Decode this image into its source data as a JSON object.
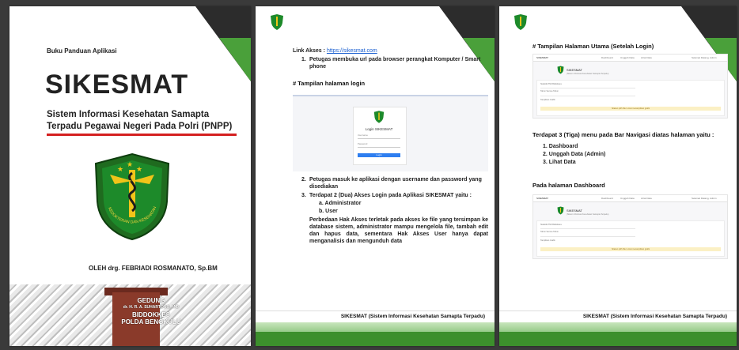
{
  "cover": {
    "guide_label": "Buku Panduan Aplikasi",
    "title": "SIKESMAT",
    "subtitle_line1": "Sistem Informasi Kesehatan Samapta",
    "subtitle_line2": "Terpadu Pegawai Negeri Pada Polri (PNPP)",
    "emblem_ring_text": "KEDOKTERAN DAN KESEHATAN",
    "author": "OLEH drg. FEBRIADI ROSMANATO, Sp.BM",
    "building_line1": "GEDUNG",
    "building_line2": "dr. H. R. A. SUHARTONO, M.D",
    "building_line3": "BIDDOKKES",
    "building_line4": "POLDA BENGKULU"
  },
  "page2": {
    "link_label": "Link Akses : ",
    "link_url": "https://sikesmat.com",
    "step1_num": "1.",
    "step1": "Petugas membuka url pada browser perangkat Komputer / Smart phone",
    "login_heading": "# Tampilan halaman login",
    "login_title": "Login SIKESMAT",
    "login_user_placeholder": "Username",
    "login_pass_placeholder": "Password",
    "login_button": "Login",
    "step2_num": "2.",
    "step2": "Petugas masuk ke aplikasi dengan username dan password yang disediakan",
    "step3_num": "3.",
    "step3": "Terdapat 2 (Dua) Akses Login pada Aplikasi SIKESMAT yaitu :",
    "sub_a": "a.   Administrator",
    "sub_b": "b.   User",
    "paragraph": "Perbedaan Hak Akses terletak pada akses ke file yang tersimpan ke database sistem, administrator mampu mengelola file, tambah edit dan hapus data, sementara Hak Akses User hanya dapat menganalisis dan mengunduh data",
    "footer": "SIKESMAT (Sistem Informasi Kesehatan Samapta Terpadu)"
  },
  "page3": {
    "heading_main": "# Tampilan Halaman Utama (Setelah Login)",
    "menu_intro": "Terdapat 3 (Tiga) menu pada Bar Navigasi diatas halaman yaitu :",
    "menu_items": [
      "1.  Dashboard",
      "2.  Unggah Data (Admin)",
      "3.  Lihat Data"
    ],
    "dashboard_heading": "Pada halaman Dashboard",
    "footer": "SIKESMAT (Sistem Informasi Kesehatan Samapta Terpadu)"
  },
  "dash_mock": {
    "brand": "SIKESMAT",
    "brand_sub": "(Sistem Informasi Kesehatan Samapta Terpadu)",
    "nav_dashboard": "Dashboard",
    "nav_unggah": "Unggah Data",
    "nav_lihat": "Lihat Data",
    "nav_user": "Selamat Datang, Admin",
    "card_title": "Statistik PNS Biddokkes",
    "card_filter": "Tahun   Semua Tahun",
    "card_sub": "Tampilkan Grafik",
    "card_notice": "Silakan pilih filter untuk menampilkan grafik"
  },
  "colors": {
    "accent_green": "#4aa03a",
    "dark_corner": "#2c2c2c",
    "red_rule": "#d42020",
    "link_blue": "#1a5fd0"
  }
}
